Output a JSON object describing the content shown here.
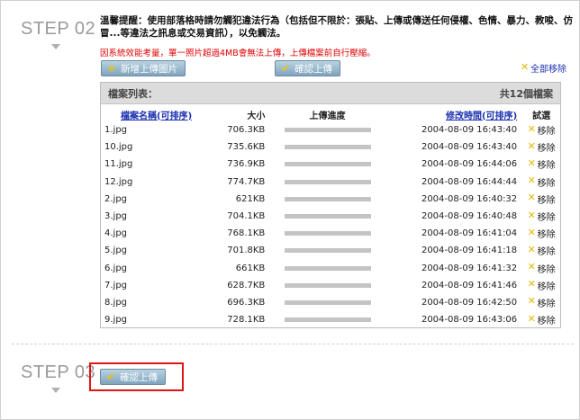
{
  "step1": {
    "label": "STEP 02"
  },
  "step2": {
    "label": "STEP 03"
  },
  "notice": {
    "warning": "溫馨提醒：使用部落格時請勿觸犯違法行為（包括但不限於：張貼、上傳或傳送任何侵權、色情、暴力、教唆、仿冒...等違法之訊息或交易資訊），以免觸法。",
    "limit_note": "因系統效能考量，單一照片超過4MB會無法上傳，上傳檔案前自行壓縮。"
  },
  "toolbar": {
    "add_label": "新增上傳圖片",
    "confirm_label": "確認上傳",
    "delete_all_label": "全部移除"
  },
  "file_list": {
    "title": "檔案列表：",
    "count": "共12個檔案",
    "columns": {
      "name": "檔案名稱(可排序)",
      "size": "大小",
      "progress": "上傳進度",
      "time": "修改時間(可排序)",
      "delete": "試選"
    },
    "delete_label": "移除",
    "rows": [
      {
        "name": "1.jpg",
        "size": "706.3KB",
        "time": "2004-08-09 16:43:40"
      },
      {
        "name": "10.jpg",
        "size": "735.6KB",
        "time": "2004-08-09 16:43:40"
      },
      {
        "name": "11.jpg",
        "size": "736.9KB",
        "time": "2004-08-09 16:44:06"
      },
      {
        "name": "12.jpg",
        "size": "774.7KB",
        "time": "2004-08-09 16:44:44"
      },
      {
        "name": "2.jpg",
        "size": "621KB",
        "time": "2004-08-09 16:40:32"
      },
      {
        "name": "3.jpg",
        "size": "704.1KB",
        "time": "2004-08-09 16:40:48"
      },
      {
        "name": "4.jpg",
        "size": "768.1KB",
        "time": "2004-08-09 16:41:04"
      },
      {
        "name": "5.jpg",
        "size": "701.8KB",
        "time": "2004-08-09 16:41:18"
      },
      {
        "name": "6.jpg",
        "size": "661KB",
        "time": "2004-08-09 16:41:32"
      },
      {
        "name": "7.jpg",
        "size": "628.7KB",
        "time": "2004-08-09 16:41:46"
      },
      {
        "name": "8.jpg",
        "size": "696.3KB",
        "time": "2004-08-09 16:42:50"
      },
      {
        "name": "9.jpg",
        "size": "728.1KB",
        "time": "2004-08-09 16:43:06"
      }
    ]
  },
  "bottom": {
    "confirm_label": "確認上傳"
  },
  "colors": {
    "accent_red": "#e01515",
    "button_blue": "#7fa4bd",
    "link_blue": "#1a2fb0",
    "warning_red": "#e00000"
  }
}
